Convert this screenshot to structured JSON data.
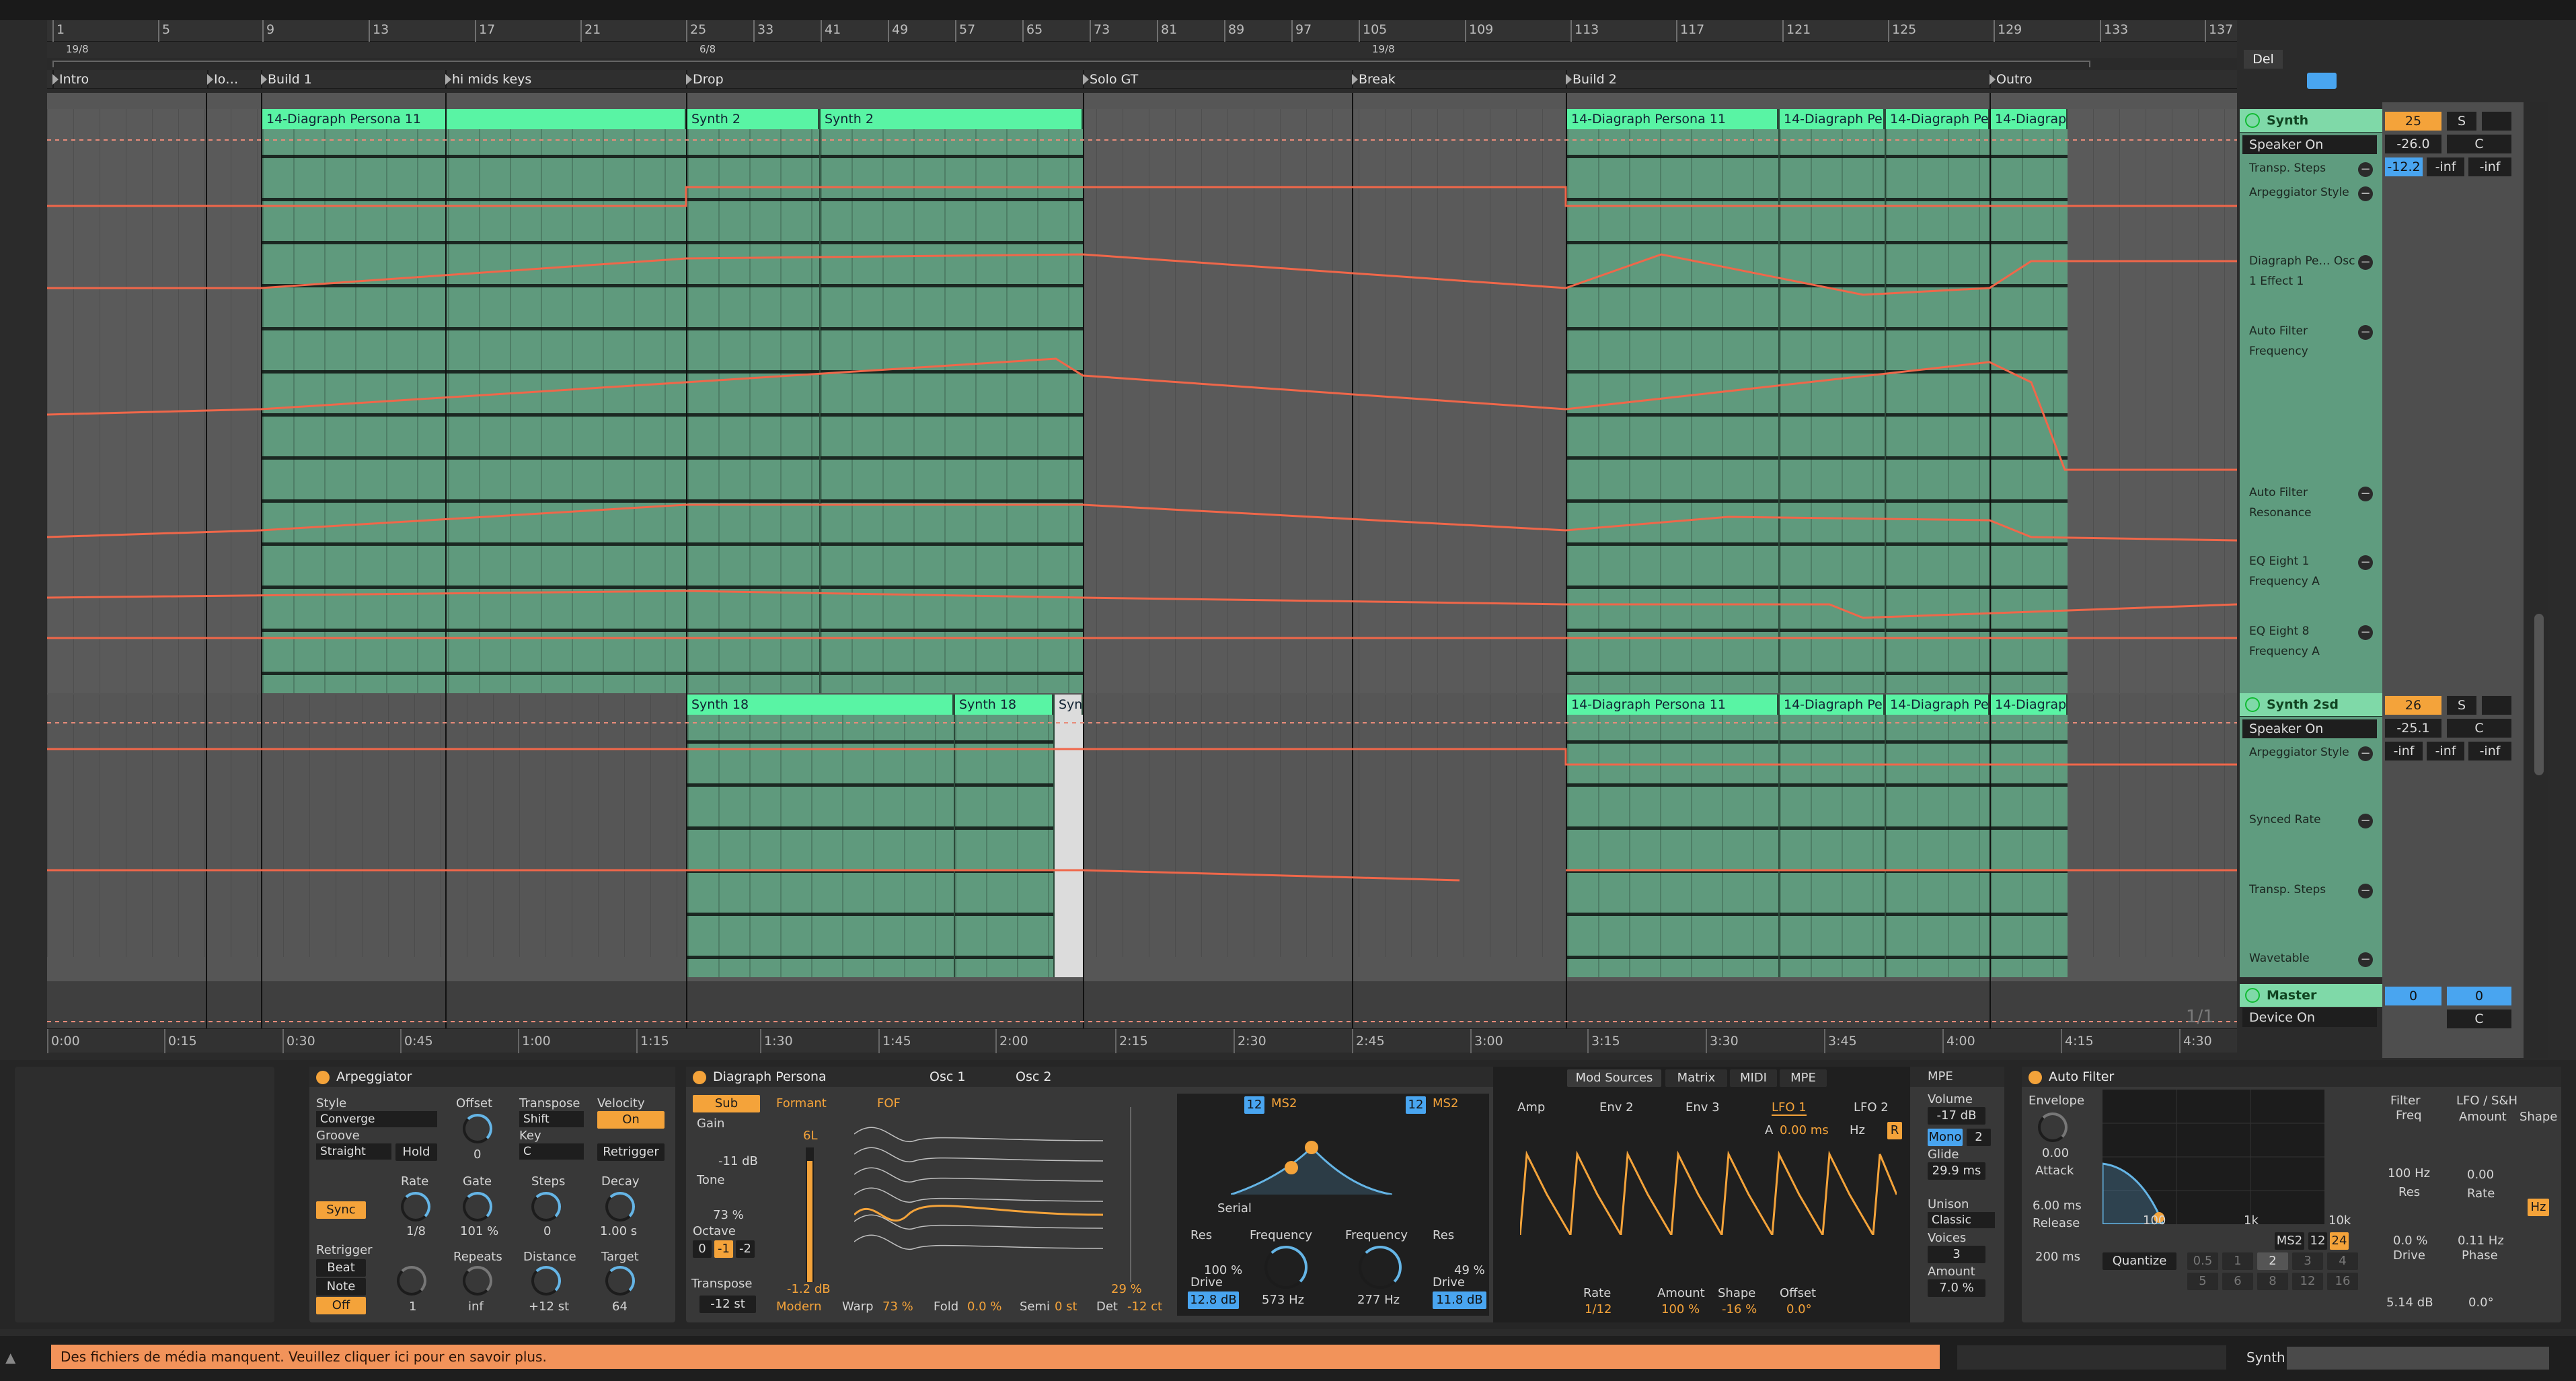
{
  "ruler": {
    "bars": [
      "1",
      "5",
      "9",
      "13",
      "17",
      "21",
      "25",
      "33",
      "41",
      "49",
      "57",
      "65",
      "73",
      "81",
      "89",
      "97",
      "105",
      "109",
      "113",
      "117",
      "121",
      "125",
      "129",
      "133",
      "137"
    ]
  },
  "signatures": [
    "19/8",
    "6/8",
    "19/8"
  ],
  "locators": [
    "Intro",
    "Io…",
    "Build 1",
    "hi mids keys",
    "Drop",
    "Solo GT",
    "Break",
    "Build 2",
    "Outro"
  ],
  "clips": {
    "track1": [
      "14-Diagraph Persona 11",
      "Synth 2",
      "Synth 2",
      "14-Diagraph Persona 11",
      "14-Diagraph Pe",
      "14-Diagraph Pe",
      "14-Diagrap"
    ],
    "track2": [
      "Synth 18",
      "Synth 18",
      "Synt",
      "14-Diagraph Persona 11",
      "14-Diagraph Pe",
      "14-Diagraph Pe",
      "14-Diagrap"
    ]
  },
  "tracks": [
    {
      "name": "Synth",
      "device": "Speaker On",
      "params": [
        "Transp. Steps",
        "Arpeggiator Style",
        "Diagraph Pe… Osc 1 Effect 1",
        "Auto Filter Frequency",
        "Auto Filter Resonance",
        "EQ Eight 1 Frequency A",
        "EQ Eight 8 Frequency A"
      ],
      "number": "25",
      "solo": "S",
      "vol": "-26.0",
      "pan": "C",
      "sends": [
        "-12.2",
        "-inf",
        "-inf"
      ]
    },
    {
      "name": "Synth 2sd",
      "device": "Speaker On",
      "params": [
        "Arpeggiator Style",
        "Synced Rate",
        "Transp. Steps",
        "Wavetable"
      ],
      "number": "26",
      "solo": "S",
      "vol": "-25.1",
      "pan": "C",
      "sends": [
        "-inf",
        "-inf",
        "-inf"
      ]
    },
    {
      "name": "Master",
      "device": "Device On",
      "number": "0",
      "num2": "0",
      "pan": "C"
    }
  ],
  "del_label": "Del",
  "zoom_label": "1/1",
  "timeline": [
    "0:00",
    "0:15",
    "0:30",
    "0:45",
    "1:00",
    "1:15",
    "1:30",
    "1:45",
    "2:00",
    "2:15",
    "2:30",
    "2:45",
    "3:00",
    "3:15",
    "3:30",
    "3:45",
    "4:00",
    "4:15",
    "4:30"
  ],
  "arpeggiator": {
    "title": "Arpeggiator",
    "style_label": "Style",
    "style": "Converge",
    "groove_label": "Groove",
    "groove": "Straight",
    "hold": "Hold",
    "offset_label": "Offset",
    "offset": "0",
    "transpose_label": "Transpose",
    "transpose": "Shift",
    "key_label": "Key",
    "key": "C",
    "velocity_label": "Velocity",
    "velocity": "On",
    "retrigger_btn": "Retrigger",
    "sync": "Sync",
    "rate_label": "Rate",
    "rate": "1/8",
    "gate_label": "Gate",
    "gate": "101 %",
    "steps_label": "Steps",
    "steps": "0",
    "decay_label": "Decay",
    "decay": "1.00 s",
    "retrig_label": "Retrigger",
    "beat": "Beat",
    "note": "Note",
    "off": "Off",
    "repeats_label": "Repeats",
    "repeats": "inf",
    "distance_label": "Distance",
    "distance": "+12 st",
    "target_label": "Target",
    "target": "64",
    "one": "1"
  },
  "persona": {
    "title": "Diagraph Persona",
    "osc1": "Osc 1",
    "osc2": "Osc 2",
    "sub": "Sub",
    "gain_label": "Gain",
    "gain": "-11 dB",
    "tone_label": "Tone",
    "tone": "73 %",
    "octave_label": "Octave",
    "oct": [
      "0",
      "-1",
      "-2"
    ],
    "transpose_label": "Transpose",
    "transpose": "-12 st",
    "formant": "Formant",
    "fof": "FOF",
    "db_top": "6L",
    "db_val": "-1.2 dB",
    "mode": "Modern",
    "warp_label": "Warp",
    "warp": "73 %",
    "fold_label": "Fold",
    "fold": "0.0 %",
    "semi_label": "Semi",
    "semi": "0 st",
    "det_label": "Det",
    "det": "-12 ct",
    "pct": "29 %"
  },
  "filters": {
    "f1_num": "12",
    "f1_type": "MS2",
    "f2_num": "12",
    "f2_type": "MS2",
    "serial": "Serial",
    "res_label": "Res",
    "res": "100 %",
    "freq_label": "Frequency",
    "freq": "573 Hz",
    "drive_label": "Drive",
    "drive": "12.8 dB",
    "freq2_label": "Frequency",
    "freq2": "277 Hz",
    "res2_label": "Res",
    "res2": "49 %",
    "drive2_label": "Drive",
    "drive2": "11.8 dB"
  },
  "mod": {
    "tabs": [
      "Mod Sources",
      "Matrix",
      "MIDI",
      "MPE"
    ],
    "subtabs": [
      "Amp",
      "Env 2",
      "Env 3",
      "LFO 1",
      "LFO 2"
    ],
    "a_label": "A",
    "a_val": "0.00 ms",
    "hz": "Hz",
    "r": "R",
    "rate_label": "Rate",
    "rate": "1/12",
    "amount_label": "Amount",
    "amount": "100 %",
    "shape_label": "Shape",
    "shape": "-16 %",
    "offset_label": "Offset",
    "offset": "0.0°",
    "mpe": "MPE",
    "volume_label": "Volume",
    "volume": "-17 dB",
    "mono": "Mono",
    "voices_num": "2",
    "glide_label": "Glide",
    "glide": "29.9 ms",
    "unison_label": "Unison",
    "unison": "Classic",
    "voices_label": "Voices",
    "voices": "3",
    "amount2_label": "Amount",
    "amount2": "7.0 %"
  },
  "autofilter": {
    "title": "Auto Filter",
    "envelope_label": "Envelope",
    "env": "0.00",
    "attack_label": "Attack",
    "attack": "6.00 ms",
    "release_label": "Release",
    "release": "200 ms",
    "filter_label": "Filter",
    "freq_label": "Freq",
    "freq": "100 Hz",
    "res_label": "Res",
    "res": "0.0 %",
    "drive_label": "Drive",
    "drive": "5.14 dB",
    "lfo_label": "LFO / S&H",
    "amount_label": "Amount",
    "amount": "0.00",
    "rate_label": "Rate",
    "rate": "0.11 Hz",
    "phase_label": "Phase",
    "phase": "0.0°",
    "shape_label": "Shape",
    "hz": "Hz",
    "k1": "1k",
    "k10": "10k",
    "k100": "100",
    "type": "MS2",
    "num12": "12",
    "num24": "24",
    "quantize": "Quantize",
    "q": [
      "0.5",
      "1",
      "2",
      "3",
      "4",
      "5",
      "6",
      "8",
      "12",
      "16"
    ]
  },
  "status": {
    "warning": "Des fichiers de média manquent. Veuillez cliquer ici pour en savoir plus.",
    "track": "Synth"
  }
}
